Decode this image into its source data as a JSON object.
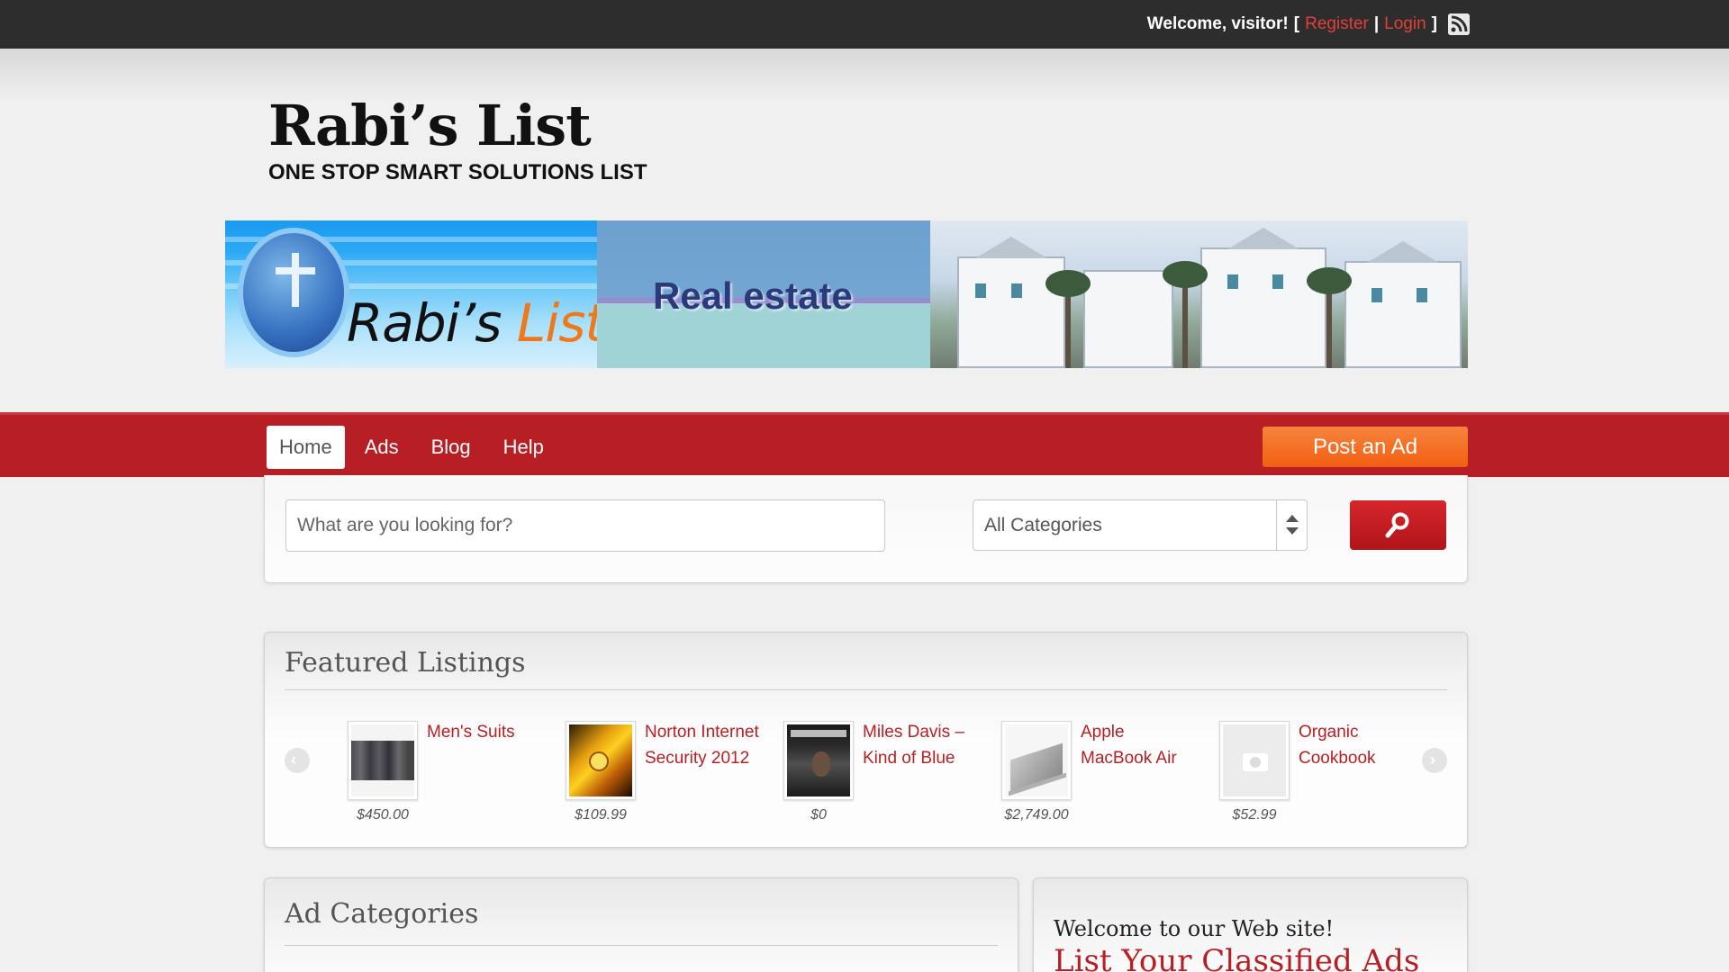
{
  "topbar": {
    "welcome": "Welcome, visitor!",
    "open_bracket": "[",
    "register": "Register",
    "separator": "|",
    "login": "Login",
    "close_bracket": "]"
  },
  "logo": {
    "title": "Rabi’s List",
    "tagline": "ONE STOP SMART SOLUTIONS LIST"
  },
  "banner": {
    "brand_main": "Rabi’s ",
    "brand_accent": "List",
    "middle_text": "Real estate"
  },
  "nav": {
    "items": [
      {
        "label": "Home",
        "active": true
      },
      {
        "label": "Ads",
        "active": false
      },
      {
        "label": "Blog",
        "active": false
      },
      {
        "label": "Help",
        "active": false
      }
    ],
    "post_ad": "Post an Ad"
  },
  "search": {
    "placeholder": "What are you looking for?",
    "category_selected": "All Categories"
  },
  "featured": {
    "title": "Featured Listings",
    "listings": [
      {
        "title": "Men's Suits",
        "price": "$450.00"
      },
      {
        "title": "Norton Internet Security 2012",
        "price": "$109.99"
      },
      {
        "title": "Miles Davis – Kind of Blue",
        "price": "$0"
      },
      {
        "title": "Apple MacBook Air",
        "price": "$2,749.00"
      },
      {
        "title": "Organic Cookbook",
        "price": "$52.99"
      }
    ]
  },
  "ad_categories": {
    "title": "Ad Categories"
  },
  "welcome_panel": {
    "text": "Welcome to our Web site!",
    "headline": "List Your Classified Ads"
  },
  "colors": {
    "brand_red": "#b81f24",
    "post_ad_orange": "#f25f12",
    "topbar_dark": "#2d2d2d",
    "link_red": "#e0403a"
  }
}
